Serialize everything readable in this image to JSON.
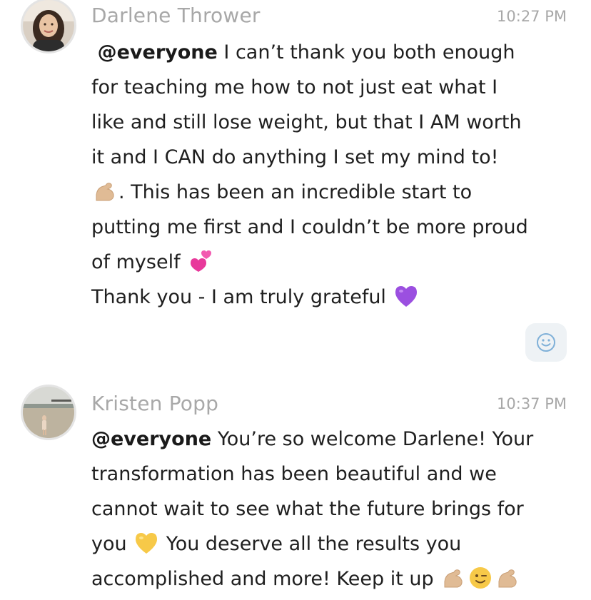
{
  "messages": [
    {
      "author": "Darlene Thrower",
      "time": "10:27 PM",
      "avatar_icon": "user-photo-woman",
      "lines": [
        {
          "mention": "@everyone",
          "text": " I can’t thank you both enough"
        },
        {
          "text": "for teaching me how to not just eat what I"
        },
        {
          "text": "like and still lose weight, but that I AM worth"
        },
        {
          "text": "it and I CAN do anything I set my mind to!"
        },
        {
          "emoji_before": "flexed-biceps",
          "text": ".  This has been an incredible start to"
        },
        {
          "text": "putting me first and I couldn’t be more proud"
        },
        {
          "text": "of myself",
          "emoji_after": "two-hearts"
        },
        {
          "text": "Thank you - I am truly grateful",
          "emoji_after": "purple-heart"
        }
      ],
      "reaction_icon": "add-reaction-smiley-icon"
    },
    {
      "author": "Kristen Popp",
      "time": "10:37 PM",
      "avatar_icon": "user-photo-beach",
      "lines": [
        {
          "mention": "@everyone",
          "text": " You’re so welcome Darlene! Your"
        },
        {
          "text": "transformation has been beautiful and we"
        },
        {
          "text": "cannot wait to see what the future brings for"
        },
        {
          "text": "you",
          "emoji_after": "yellow-heart",
          "text_after": " You deserve all the results you"
        },
        {
          "text": "accomplished and more! Keep it up",
          "emoji_after": "flexed-biceps,winking-face,flexed-biceps"
        }
      ]
    }
  ],
  "colors": {
    "meta_text": "#a8a8a8",
    "body_text": "#1f1f1f",
    "reaction_bg": "#eef2f5",
    "reaction_icon": "#7fb0d8",
    "purple_heart": "#9b4fe0",
    "yellow_heart": "#f7c948",
    "pink_hearts": "#e8399b",
    "skin_tone": "#e0bb95"
  }
}
